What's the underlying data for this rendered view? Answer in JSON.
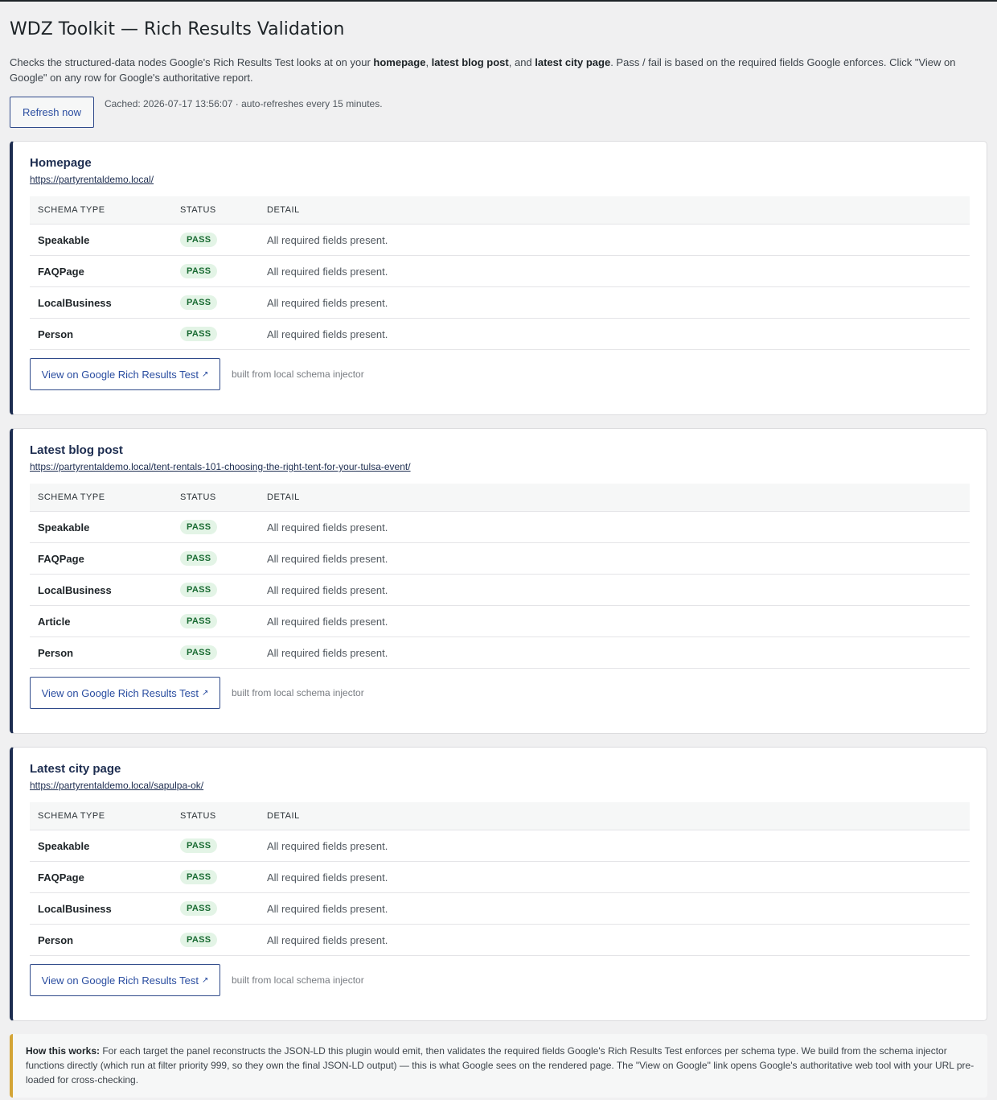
{
  "page": {
    "title": "WDZ Toolkit — Rich Results Validation",
    "intro": {
      "p1": "Checks the structured-data nodes Google's Rich Results Test looks at on your ",
      "b1": "homepage",
      "p2": ", ",
      "b2": "latest blog post",
      "p3": ", and ",
      "b3": "latest city page",
      "p4": ". Pass / fail is based on the required fields Google enforces. Click \"View on Google\" on any row for Google's authoritative report."
    },
    "refresh_label": "Refresh now",
    "cached_text": "Cached: 2026-07-17 13:56:07 · auto-refreshes every 15 minutes."
  },
  "table_headers": {
    "type": "SCHEMA TYPE",
    "status": "STATUS",
    "detail": "DETAIL"
  },
  "cards": [
    {
      "title": "Homepage",
      "url": "https://partyrentaldemo.local/",
      "rows": [
        {
          "type": "Speakable",
          "status": "PASS",
          "detail": "All required fields present."
        },
        {
          "type": "FAQPage",
          "status": "PASS",
          "detail": "All required fields present."
        },
        {
          "type": "LocalBusiness",
          "status": "PASS",
          "detail": "All required fields present."
        },
        {
          "type": "Person",
          "status": "PASS",
          "detail": "All required fields present."
        }
      ],
      "button_label": "View on Google Rich Results Test",
      "note": "built from local schema injector"
    },
    {
      "title": "Latest blog post",
      "url": "https://partyrentaldemo.local/tent-rentals-101-choosing-the-right-tent-for-your-tulsa-event/",
      "rows": [
        {
          "type": "Speakable",
          "status": "PASS",
          "detail": "All required fields present."
        },
        {
          "type": "FAQPage",
          "status": "PASS",
          "detail": "All required fields present."
        },
        {
          "type": "LocalBusiness",
          "status": "PASS",
          "detail": "All required fields present."
        },
        {
          "type": "Article",
          "status": "PASS",
          "detail": "All required fields present."
        },
        {
          "type": "Person",
          "status": "PASS",
          "detail": "All required fields present."
        }
      ],
      "button_label": "View on Google Rich Results Test",
      "note": "built from local schema injector"
    },
    {
      "title": "Latest city page",
      "url": "https://partyrentaldemo.local/sapulpa-ok/",
      "rows": [
        {
          "type": "Speakable",
          "status": "PASS",
          "detail": "All required fields present."
        },
        {
          "type": "FAQPage",
          "status": "PASS",
          "detail": "All required fields present."
        },
        {
          "type": "LocalBusiness",
          "status": "PASS",
          "detail": "All required fields present."
        },
        {
          "type": "Person",
          "status": "PASS",
          "detail": "All required fields present."
        }
      ],
      "button_label": "View on Google Rich Results Test",
      "note": "built from local schema injector"
    }
  ],
  "external_arrow_icon": "↗",
  "how": {
    "label": "How this works:",
    "text": " For each target the panel reconstructs the JSON-LD this plugin would emit, then validates the required fields Google's Rich Results Test enforces per schema type. We build from the schema injector functions directly (which run at filter priority 999, so they own the final JSON-LD output) — this is what Google sees on the rendered page. The \"View on Google\" link opens Google's authoritative web tool with your URL pre-loaded for cross-checking."
  },
  "colors": {
    "accent": "#2a4da0",
    "card_border_left": "#1d2d50",
    "pass_bg": "#e3f4e6",
    "pass_text": "#1a6b33",
    "how_border": "#d4a537"
  }
}
